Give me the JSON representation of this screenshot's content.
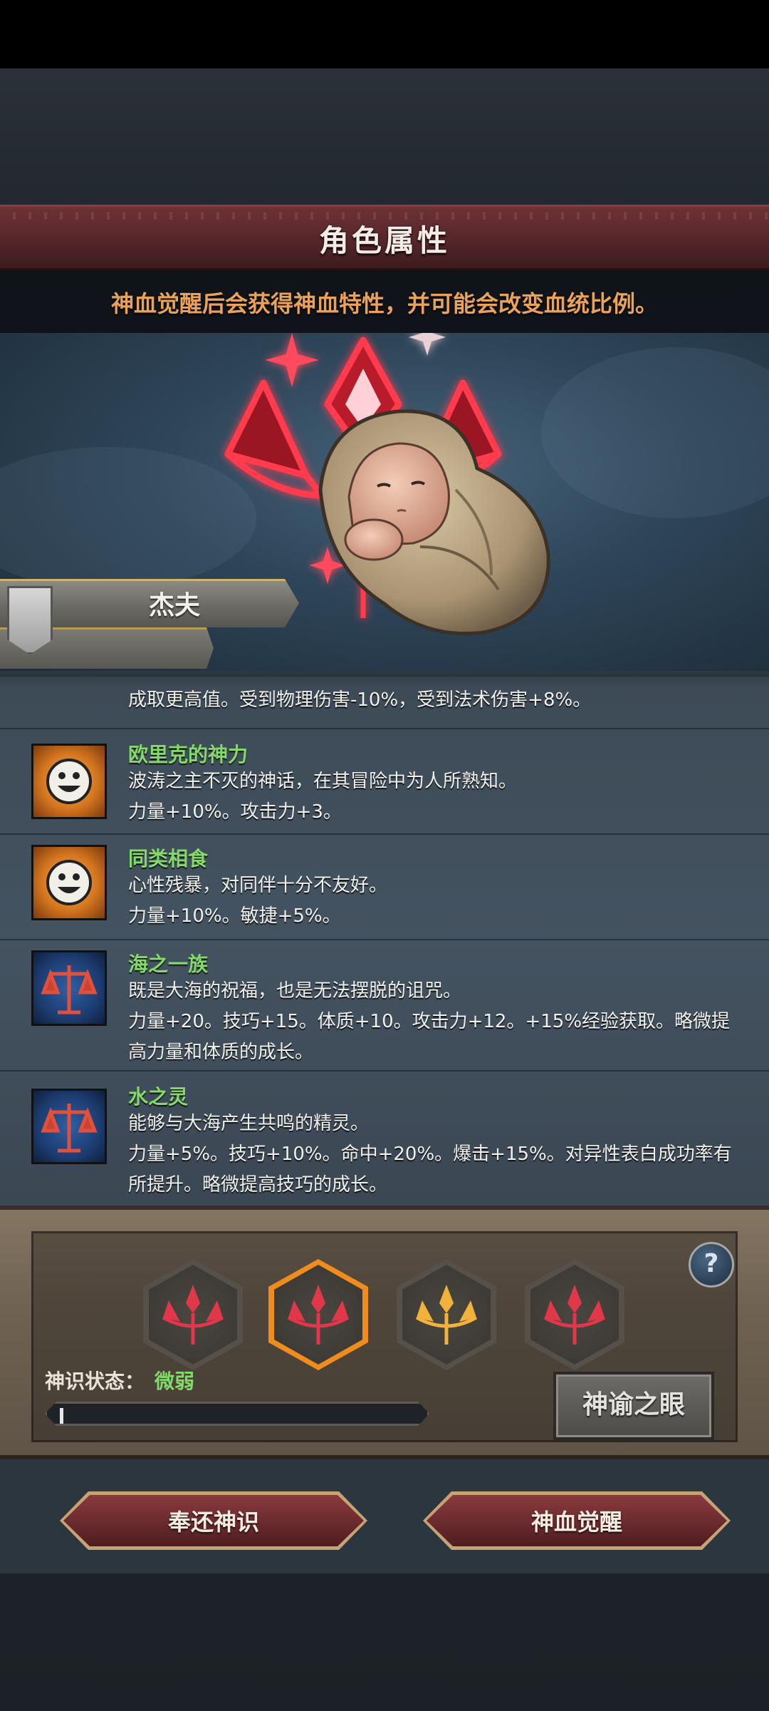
{
  "header": {
    "title": "角色属性",
    "subtitle": "神血觉醒后会获得神血特性，并可能会改变血统比例。"
  },
  "character": {
    "name": "杰夫"
  },
  "traits": {
    "partial_desc": "成取更高值。受到物理伤害-10%，受到法术伤害+8%。",
    "items": [
      {
        "icon": "smile-icon",
        "name": "欧里克的神力",
        "desc": "波涛之主不灭的神话，在其冒险中为人所熟知。",
        "effect": "力量+10%。攻击力+3。"
      },
      {
        "icon": "smile-icon",
        "name": "同类相食",
        "desc": "心性残暴，对同伴十分不友好。",
        "effect": "力量+10%。敏捷+5%。"
      },
      {
        "icon": "scale-icon",
        "name": "海之一族",
        "desc": "既是大海的祝福，也是无法摆脱的诅咒。",
        "effect": "力量+20。技巧+15。体质+10。攻击力+12。+15%经验获取。略微提高力量和体质的成长。"
      },
      {
        "icon": "scale-icon",
        "name": "水之灵",
        "desc": "能够与大海产生共鸣的精灵。",
        "effect": "力量+5%。技巧+10%。命中+20%。爆击+15%。对异性表白成功率有所提升。略微提高技巧的成长。"
      }
    ]
  },
  "awakening": {
    "status_label": "神识状态：",
    "status_value": "微弱",
    "progress": 0.01,
    "oracle_button": "神谕之眼",
    "help_label": "?",
    "sigils": [
      {
        "name": "red-sigil-icon",
        "color": "#e0384a"
      },
      {
        "name": "red-sigil-icon",
        "color": "#e0384a",
        "selected": true
      },
      {
        "name": "gold-sigil-icon",
        "color": "#f0b23a"
      },
      {
        "name": "red-sigil-icon",
        "color": "#e0384a"
      }
    ]
  },
  "actions": {
    "return_label": "奉还神识",
    "awaken_label": "神血觉醒"
  },
  "colors": {
    "accent_orange": "#eaa25a",
    "trait_green": "#83d96a",
    "banner_red": "#6e3236",
    "selected_orange": "#f08c1e"
  }
}
